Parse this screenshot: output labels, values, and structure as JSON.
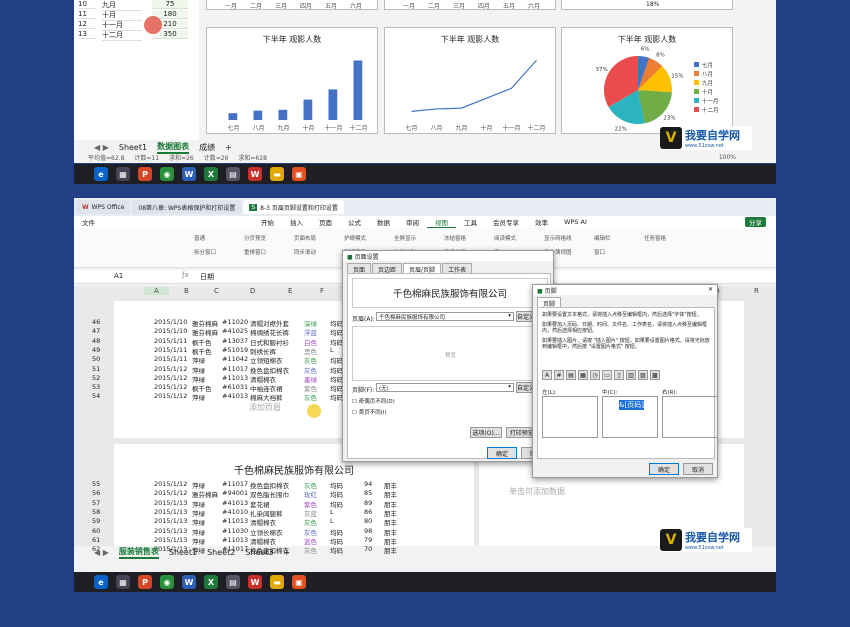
{
  "top": {
    "rows": [
      {
        "num": "10",
        "month": "九月",
        "value": "75"
      },
      {
        "num": "11",
        "month": "十月",
        "value": "180"
      },
      {
        "num": "12",
        "month": "十一月",
        "value": "210"
      },
      {
        "num": "13",
        "month": "十二月",
        "value": "350"
      }
    ],
    "chart_bar_title": "下半年 观影人数",
    "chart_line_title": "下半年 观影人数",
    "chart_pie_title": "下半年 观影人数",
    "months": [
      "七月",
      "八月",
      "九月",
      "十月",
      "十一月",
      "十二月"
    ],
    "top_chart_ticks": [
      "一月",
      "二月",
      "三月",
      "四月",
      "五月",
      "六月"
    ],
    "pie_top_label": "18%",
    "sheet_tabs": [
      "Sheet1",
      "数据图表",
      "成绩"
    ],
    "add_tab": "+",
    "status": [
      "平均值=62.8",
      "计数=11",
      "求和=26",
      "计数=26",
      "求和=628"
    ],
    "zoom": "100%"
  },
  "chart_data": [
    {
      "type": "bar",
      "title": "下半年 观影人数",
      "categories": [
        "七月",
        "八月",
        "九月",
        "十月",
        "十一月",
        "十二月"
      ],
      "values": [
        40,
        55,
        60,
        120,
        180,
        350
      ],
      "ylim": [
        0,
        400
      ]
    },
    {
      "type": "line",
      "title": "下半年 观影人数",
      "categories": [
        "七月",
        "八月",
        "九月",
        "十月",
        "十一月",
        "十二月"
      ],
      "values": [
        40,
        55,
        60,
        120,
        180,
        350
      ],
      "ylim": [
        0,
        400
      ]
    },
    {
      "type": "pie",
      "title": "下半年 观影人数",
      "categories": [
        "七月",
        "八月",
        "九月",
        "十月",
        "十一月",
        "十二月"
      ],
      "values": [
        6,
        8,
        15,
        23,
        22,
        37
      ],
      "labels": [
        "6%",
        "8%",
        "15%",
        "23%",
        "22%",
        "37%"
      ],
      "colors": [
        "#4472c4",
        "#ed7d31",
        "#ffc000",
        "#70ad47",
        "#2bb3c0",
        "#e84c4c"
      ]
    }
  ],
  "bottom": {
    "app_tabs": [
      "WPS Office",
      "08第八章: WPS表格保护和打印设置",
      "8-3 页眉页脚设置和打印设置"
    ],
    "menu": [
      "文件",
      "开始",
      "插入",
      "页面",
      "公式",
      "数据",
      "审阅",
      "视图",
      "工具",
      "会员专享",
      "效率",
      "WPS AI"
    ],
    "active_menu": "视图",
    "share": "分享",
    "ribbon_labels": [
      "普通",
      "分页预览",
      "页面布局",
      "护眼模式",
      "全屏显示",
      "冻结窗格",
      "阅读模式",
      "显示网格线",
      "编辑栏",
      "任务窗格",
      "拆分窗口",
      "重排窗口",
      "同步滚动",
      "新建窗口",
      "并排比较",
      "重设位置",
      "宏",
      "工作簿视图",
      "窗口"
    ],
    "cell_ref": "A1",
    "formula": "日期",
    "columns": [
      "A",
      "B",
      "C",
      "D",
      "E",
      "F",
      "G",
      "M",
      "N",
      "O",
      "P",
      "Q",
      "R"
    ],
    "rows_top": [
      [
        "46",
        "2015/1/10",
        "雅芬棉麻",
        "#11020",
        "清帽对襟外套",
        "深绿",
        "均码"
      ],
      [
        "47",
        "2015/1/10",
        "雅芬棉麻",
        "#41025",
        "棉绸绣花长裤",
        "浮蓝",
        "均码"
      ],
      [
        "48",
        "2015/1/11",
        "枫千色",
        "#13037",
        "日式和服衬衫",
        "白色",
        "均码"
      ],
      [
        "49",
        "2015/1/11",
        "枫千色",
        "#51019",
        "刺绣长裤",
        "黑色",
        "L"
      ],
      [
        "50",
        "2015/1/11",
        "萍绿",
        "#11042",
        "立领短棉衣",
        "灰色",
        "均码"
      ],
      [
        "51",
        "2015/1/12",
        "萍绿",
        "#11017",
        "挽色盘扣棉衣",
        "灰色",
        "均码"
      ],
      [
        "52",
        "2015/1/12",
        "萍绿",
        "#11013",
        "清帽棉衣",
        "墨绿",
        "均码"
      ],
      [
        "53",
        "2015/1/12",
        "枫千色",
        "#61031",
        "中袖连衣裙",
        "紫色",
        "均码"
      ],
      [
        "54",
        "2015/1/12",
        "萍绿",
        "#41013",
        "棉麻大裆裤",
        "灰色",
        "均码"
      ]
    ],
    "add_header_hint": "添加页眉",
    "click_add_data": "单击可添加数据",
    "page_header_text": "千色棉麻民族服饰有限公司",
    "rows_bottom": [
      [
        "55",
        "2015/1/12",
        "萍绿",
        "#11017",
        "挽色盘扣棉衣",
        "灰色",
        "均码",
        "94",
        "朋丰"
      ],
      [
        "56",
        "2015/1/12",
        "雅芬棉麻",
        "#94001",
        "双色脂长围巾",
        "玫红",
        "均码",
        "85",
        "朋丰"
      ],
      [
        "57",
        "2015/1/13",
        "萍绿",
        "#41013",
        "套花裙",
        "紫色",
        "均码",
        "89",
        "朋丰"
      ],
      [
        "58",
        "2015/1/13",
        "萍绿",
        "#41010",
        "扎染阔腿裤",
        "灰蓝",
        "L",
        "86",
        "朋丰"
      ],
      [
        "59",
        "2015/1/13",
        "萍绿",
        "#11013",
        "清帽棉衣",
        "灰色",
        "L",
        "80",
        "朋丰"
      ],
      [
        "60",
        "2015/1/13",
        "萍绿",
        "#11030",
        "立领长棉衣",
        "灰色",
        "均码",
        "98",
        "朋丰"
      ],
      [
        "61",
        "2015/1/13",
        "萍绿",
        "#11013",
        "清帽棉衣",
        "蓝色",
        "均码",
        "79",
        "朋丰"
      ],
      [
        "62",
        "2015/1/13",
        "萍绿",
        "#11017",
        "挽色盘扣棉衣",
        "灰色",
        "均码",
        "70",
        "朋丰"
      ]
    ],
    "sheet_tabs": [
      "服装销售表",
      "Sheet1",
      "Sheet2",
      "Sheet3"
    ],
    "add_tab": "+",
    "page_setup": {
      "title": "页面设置",
      "tabs": [
        "页面",
        "页边距",
        "页眉/页脚",
        "工作表"
      ],
      "active_tab": "页眉/页脚",
      "preview_header": "千色棉麻民族服饰有限公司",
      "header_label": "页眉(A):",
      "header_value": "千色棉麻民族服饰有限公司",
      "custom_header_btn": "自定义页眉",
      "preview_label": "预览",
      "footer_label": "页脚(F):",
      "footer_value": "(无)",
      "custom_footer_btn": "自定义页脚",
      "odd_even": "奇偶页不同(D)",
      "first_page": "首页不同(I)",
      "options_btn": "选项(O)...",
      "print_preview_btn": "打印预览(W)",
      "ok_btn": "确定",
      "cancel_btn": "取消"
    },
    "footer_dialog": {
      "title": "页脚",
      "tab": "页脚",
      "help1": "如果要设置文本格式，请将插入点移至编辑框内，然后选择\"字体\"按钮。",
      "help2": "如果要加入页码、日期、时间、文件名、工作表名，请将插入点移至编辑框内，然后选择相应按钮。",
      "help3": "如果要插入图片，请按 \"插入图片\" 按钮。如果要设置图片格式，请将光标放到编辑框中，然后按 \"设置图片格式\" 按钮。",
      "left_label": "左(L):",
      "center_label": "中(C):",
      "right_label": "右(R):",
      "center_value": "&[页码]",
      "ok_btn": "确定",
      "cancel_btn": "取消"
    },
    "watermark": {
      "main": "我要自学网",
      "url": "www.51zxw.net"
    }
  }
}
